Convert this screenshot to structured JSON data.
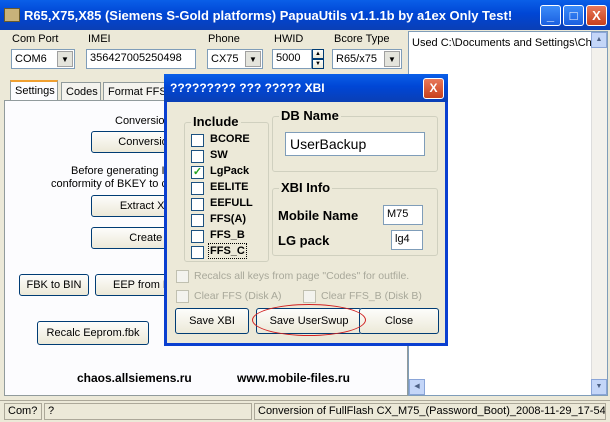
{
  "window": {
    "title": "R65,X75,X85 (Siemens S-Gold platforms) PapuaUtils v1.1.1b by a1ex Only Test!",
    "min_glyph": "_",
    "max_glyph": "□",
    "close_glyph": "X"
  },
  "top": {
    "com_port_label": "Com Port",
    "com_port_value": "COM6",
    "imei_label": "IMEI",
    "imei_value": "356427005250498",
    "phone_label": "Phone",
    "phone_value": "CX75",
    "hwid_label": "HWID",
    "hwid_value": "5000",
    "bcore_label": "Bcore Type",
    "bcore_value": "R65/x75"
  },
  "tabs": [
    "Settings",
    "Codes",
    "Format FFS"
  ],
  "panel": {
    "line1": "Conversion of th",
    "conversion_btn": "Conversion F",
    "line2": "Before generating I",
    "line3": "conformity of BKEY to c",
    "extract_btn": "Extract XBZ(",
    "create_btn": "Create B",
    "fbk_btn": "FBK  to BIN",
    "eep_btn": "EEP from FB",
    "recalc_btn": "Recalc Eeprom.fbk",
    "link1": "chaos.allsiemens.ru",
    "link2": "www.mobile-files.ru"
  },
  "log": {
    "line1": "Used C:\\Documents and Settings\\Ch"
  },
  "status": {
    "p1": "Com?",
    "p2": "?",
    "p3": "Conversion of FullFlash CX_M75_(Password_Boot)_2008-11-29_17-54"
  },
  "dialog": {
    "title": "????????? ??? ????? XBI",
    "close_glyph": "X",
    "include_label": "Include",
    "include_items": [
      {
        "label": "BCORE",
        "checked": false
      },
      {
        "label": "SW",
        "checked": false
      },
      {
        "label": "LgPack",
        "checked": true
      },
      {
        "label": "EELITE",
        "checked": false
      },
      {
        "label": "EEFULL",
        "checked": false
      },
      {
        "label": "FFS(A)",
        "checked": false
      },
      {
        "label": "FFS_B",
        "checked": false
      },
      {
        "label": "FFS_C",
        "checked": false
      }
    ],
    "check_glyph": "✓",
    "dbname_label": "DB Name",
    "dbname_value": "UserBackup",
    "xbiinfo_label": "XBI Info",
    "mobile_name_label": "Mobile Name",
    "mobile_name_value": "M75",
    "lg_pack_label": "LG pack",
    "lg_pack_value": "lg4",
    "recalc_label": "Recalcs all keys from page \"Codes\" for outfile.",
    "clear_ffs_label": "Clear FFS (Disk A)",
    "clear_ffsb_label": "Clear FFS_B (Disk B)",
    "save_xbi": "Save XBI",
    "save_userswup": "Save UserSwup",
    "close_btn": "Close",
    "highlight_color": "#d02020"
  }
}
